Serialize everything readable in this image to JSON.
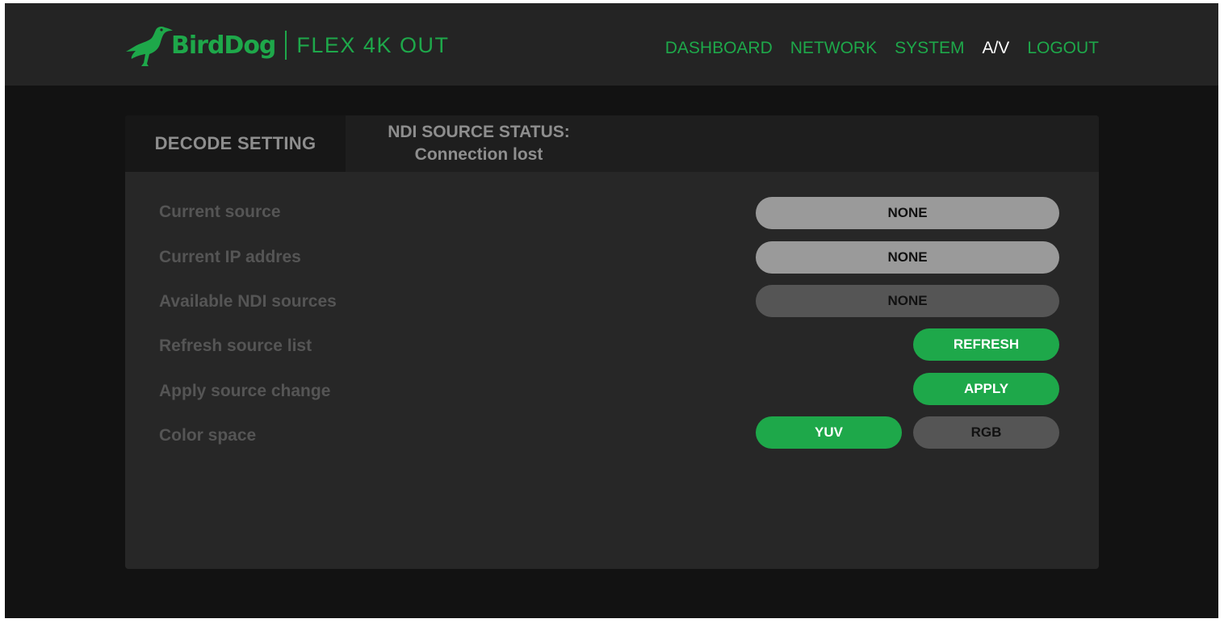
{
  "brand": {
    "name": "BirdDog",
    "product": "FLEX 4K OUT",
    "accent_color": "#1ea84a",
    "logo_icon": "bird-icon"
  },
  "nav": {
    "items": [
      {
        "label": "DASHBOARD",
        "active": false
      },
      {
        "label": "NETWORK",
        "active": false
      },
      {
        "label": "SYSTEM",
        "active": false
      },
      {
        "label": "A/V",
        "active": true
      },
      {
        "label": "LOGOUT",
        "active": false
      }
    ]
  },
  "tabs": {
    "decode": "DECODE SETTING",
    "status_line1": "NDI SOURCE STATUS:",
    "status_line2": "Connection lost"
  },
  "rows": {
    "current_source": {
      "label": "Current source",
      "value": "NONE"
    },
    "current_ip": {
      "label": "Current IP addres",
      "value": "NONE"
    },
    "available_sources": {
      "label": "Available NDI sources",
      "value": "NONE"
    },
    "refresh": {
      "label": "Refresh source list",
      "button": "REFRESH"
    },
    "apply": {
      "label": "Apply source change",
      "button": "APPLY"
    },
    "color_space": {
      "label": "Color space",
      "options": [
        "YUV",
        "RGB"
      ],
      "selected": "YUV"
    }
  }
}
